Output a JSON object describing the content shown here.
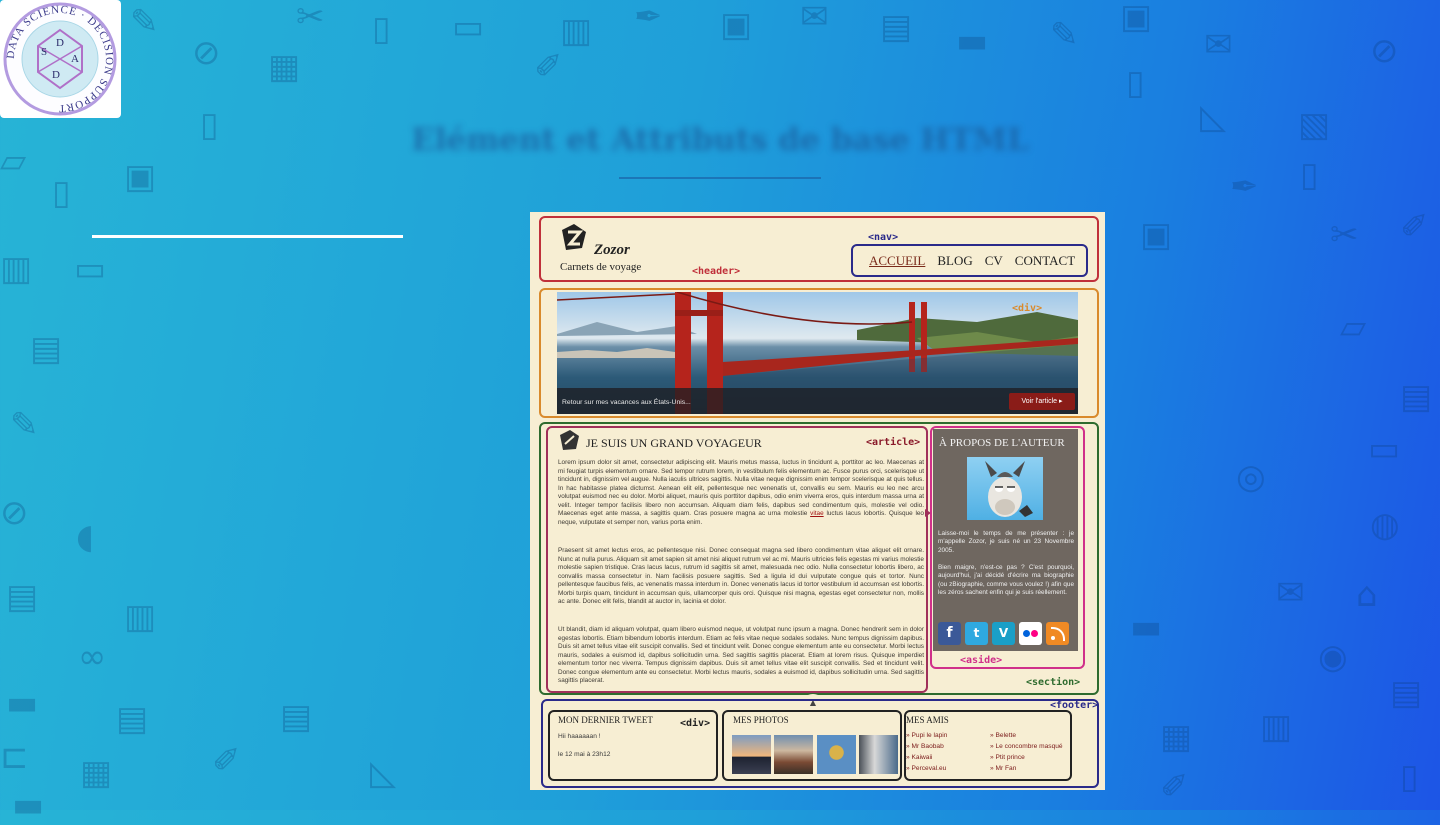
{
  "slide": {
    "title": "Elément et Attributs de base HTML",
    "logo_text": "DATA SCIENCE · DECISION SUPPORT",
    "logo_letters": [
      "S",
      "D",
      "A",
      "D"
    ]
  },
  "mockup": {
    "header": {
      "logo_name": "Zozor",
      "logo_tagline": "Carnets de voyage",
      "tag": "<header>",
      "nav_tag": "<nav>",
      "nav_items": [
        "ACCUEIL",
        "BLOG",
        "CV",
        "CONTACT"
      ]
    },
    "banner": {
      "tag": "<div>",
      "caption": "Retour sur mes vacances aux États-Unis...",
      "button": "Voir l'article ▸"
    },
    "section": {
      "tag": "<section>",
      "article": {
        "tag": "<article>",
        "title": "JE SUIS UN GRAND VOYAGEUR",
        "link_word": "vitae",
        "p1a": "Lorem ipsum dolor sit amet, consectetur adipiscing elit. Mauris metus massa, luctus in tincidunt a, porttitor ac leo. Maecenas at mi feugiat turpis elementum ornare. Sed tempor rutrum lorem, in vestibulum felis elementum ac. Fusce purus orci, scelerisque ut tincidunt in, dignissim vel augue. Nulla iaculis ultrices sagittis. Nulla vitae neque dignissim enim tempor scelerisque at quis tellus. In hac habitasse platea dictumst. Aenean elit elit, pellentesque nec venenatis ut, convallis eu sem. Mauris eu leo nec arcu volutpat euismod nec eu dolor. Morbi aliquet, mauris quis porttitor dapibus, odio enim viverra eros, quis interdum massa urna at velit. Integer tempor facilisis libero non accumsan. Aliquam diam felis, dapibus sed condimentum quis, molestie vel odio. Maecenas eget ante massa, a sagittis quam. Cras posuere magna ac urna molestie",
        "p1b": "luctus lacus lobortis. Quisque leo neque, vulputate et semper non, varius porta enim.",
        "p2": "Praesent sit amet lectus eros, ac pellentesque nisi. Donec consequat magna sed libero condimentum vitae aliquet elit ornare. Nunc at nulla purus. Aliquam sit amet sapien sit amet nisi aliquet rutrum vel ac mi. Mauris ultricies felis egestas mi varius molestie molestie sapien tristique. Cras lacus lacus, rutrum id sagittis sit amet, malesuada nec odio. Nulla consectetur lobortis libero, ac convallis massa consectetur in. Nam facilisis posuere sagittis. Sed a ligula id dui vulputate congue quis et tortor. Nunc pellentesque faucibus felis, ac venenatis massa interdum in. Donec venenatis lacus id tortor vestibulum id accumsan est lobortis. Morbi turpis quam, tincidunt in accumsan quis, ullamcorper quis orci. Quisque nisi magna, egestas eget consectetur non, mollis ac ante. Donec elit felis, blandit at auctor in, lacinia et dolor.",
        "p3": "Ut blandit, diam id aliquam volutpat, quam libero euismod neque, ut volutpat nunc ipsum a magna. Donec hendrerit sem in dolor egestas lobortis. Etiam bibendum lobortis interdum. Etiam ac felis vitae neque sodales sodales. Nunc tempus dignissim dapibus. Duis sit amet tellus vitae elit suscipit convallis. Sed et tincidunt velit. Donec congue elementum ante eu consectetur. Morbi lectus mauris, sodales a euismod id, dapibus sollicitudin urna. Sed sagittis sagittis placerat. Etiam at lorem risus. Quisque imperdiet elementum tortor nec viverra. Tempus dignissim dapibus. Duis sit amet tellus vitae elit suscipit convallis. Sed et tincidunt velit. Donec congue elementum ante eu consectetur. Morbi lectus mauris, sodales a euismod id, dapibus sollicitudin urna. Sed sagittis sagittis placerat."
      },
      "aside": {
        "tag": "<aside>",
        "title": "À PROPOS DE L'AUTEUR",
        "p1": "Laisse-moi le temps de me présenter : je m'appelle Zozor, je suis né un 23 Novembre 2005.",
        "p2": "Bien maigre, n'est-ce pas ? C'est pourquoi, aujourd'hui, j'ai décidé d'écrire ma biographie (ou zBiographie, comme vous voulez !) afin que les zéros sachent enfin qui je suis réellement.",
        "socials": [
          {
            "name": "facebook-icon",
            "glyph": "f",
            "color": "#3b5998"
          },
          {
            "name": "twitter-icon",
            "glyph": "t",
            "color": "#2fa9e0"
          },
          {
            "name": "vimeo-icon",
            "glyph": "V",
            "color": "#1a9fc7"
          },
          {
            "name": "flickr-icon",
            "glyph": "●●",
            "color": "#ffffff"
          },
          {
            "name": "rss-icon",
            "glyph": "◉",
            "color": "#f08a24"
          }
        ]
      }
    },
    "footer": {
      "tag": "<footer>",
      "tweet": {
        "tag": "<div>",
        "title": "MON DERNIER TWEET",
        "text": "Hii haaaaaan !",
        "date": "le 12 mai à 23h12"
      },
      "photos": {
        "title": "MES PHOTOS"
      },
      "friends": {
        "title": "MES AMIS",
        "col1": [
          "Pupi le lapin",
          "Mr Baobab",
          "Kaiwaii",
          "Perceval.eu"
        ],
        "col2": [
          "Belette",
          "Le concombre masqué",
          "Ptit prince",
          "Mr Fan"
        ]
      }
    }
  }
}
